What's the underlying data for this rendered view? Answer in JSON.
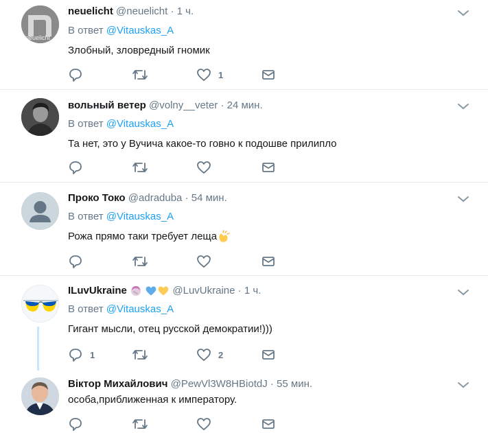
{
  "tweets": [
    {
      "name": "neuelicht",
      "handle": "@neuelicht",
      "dot": "·",
      "time": "1 ч.",
      "reply_prefix": "В ответ",
      "reply_mention": "@Vitauskas_A",
      "text": "Злобный, зловредный гномик",
      "reply_count": "",
      "retweet_count": "",
      "like_count": "1",
      "avatar_text": "neuelicht"
    },
    {
      "name": "вольный ветер",
      "handle": "@volny__veter",
      "dot": "·",
      "time": "24 мин.",
      "reply_prefix": "В ответ",
      "reply_mention": "@Vitauskas_A",
      "text": "Та нет, это у Вучича какое-то говно к подошве прилипло",
      "reply_count": "",
      "retweet_count": "",
      "like_count": ""
    },
    {
      "name": "Проко Токо",
      "handle": "@adraduba",
      "dot": "·",
      "time": "54 мин.",
      "reply_prefix": "В ответ",
      "reply_mention": "@Vitauskas_A",
      "text": "Рожа прямо таки требует леща",
      "reply_count": "",
      "retweet_count": "",
      "like_count": ""
    },
    {
      "name": "ILuvUkraine",
      "handle": "@LuvUkraine",
      "dot": "·",
      "time": "1 ч.",
      "reply_prefix": "В ответ",
      "reply_mention": "@Vitauskas_A",
      "text": "Гигант мысли, отец русской демократии!)))",
      "reply_count": "1",
      "retweet_count": "",
      "like_count": "2"
    },
    {
      "name": "Віктор Михайлович",
      "handle": "@PewVl3W8HBiotdJ",
      "dot": "·",
      "time": "55 мин.",
      "text": "особа,приближенная к императору.",
      "reply_count": "",
      "retweet_count": "",
      "like_count": ""
    }
  ],
  "icons": {
    "reply": "reply-icon",
    "retweet": "retweet-icon",
    "like": "heart-icon",
    "dm": "envelope-icon",
    "more": "chevron-down-icon",
    "clap": "clapping-hands-emoji",
    "facepalm": "woman-facepalming-emoji",
    "blue_heart": "blue-heart-emoji",
    "yellow_heart": "yellow-heart-emoji"
  },
  "colors": {
    "link": "#1da1f2",
    "muted": "#657786",
    "text": "#14171a",
    "thread_line": "#cce6f9"
  }
}
